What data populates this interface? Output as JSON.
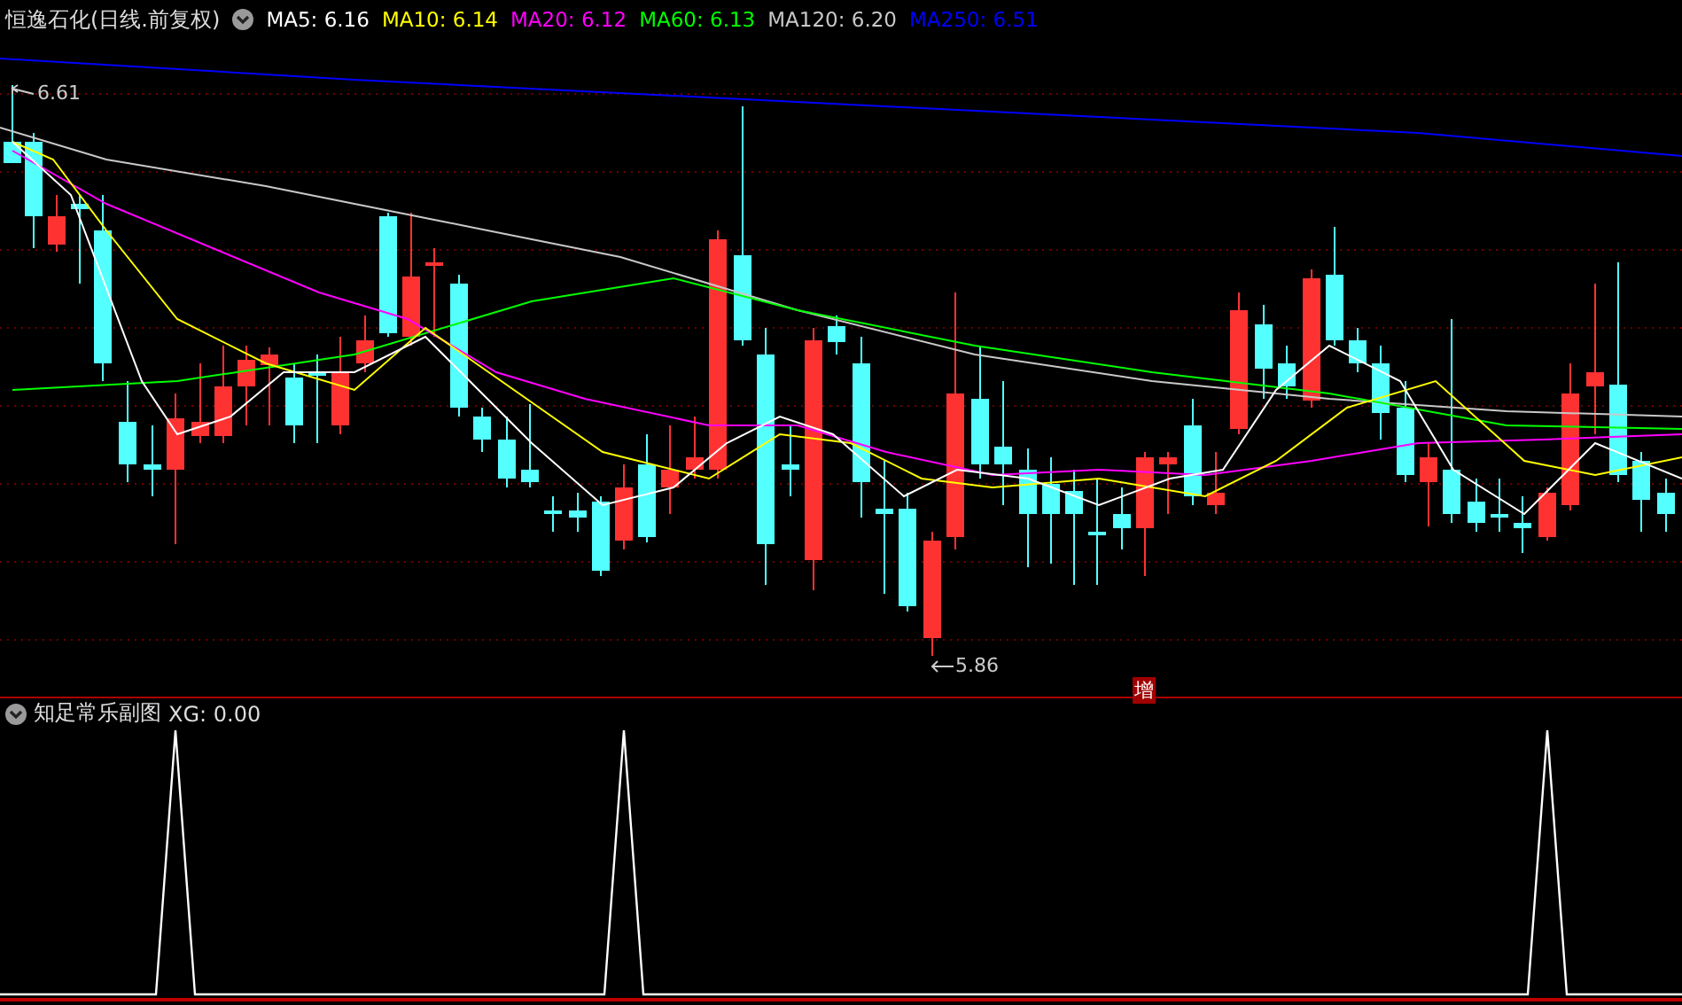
{
  "main_chart": {
    "title": "恒逸石化(日线.前复权)",
    "indicators": [
      {
        "label": "MA5: 6.16",
        "color": "#ffffff"
      },
      {
        "label": "MA10: 6.14",
        "color": "#ffff00"
      },
      {
        "label": "MA20: 6.12",
        "color": "#ff00ff"
      },
      {
        "label": "MA60: 6.13",
        "color": "#00ff00"
      },
      {
        "label": "MA120: 6.20",
        "color": "#c8c8c8"
      },
      {
        "label": "MA250: 6.51",
        "color": "#0000ff"
      }
    ],
    "high_marker": "6.61",
    "low_marker": "5.86",
    "badge": "增"
  },
  "sub_chart": {
    "title": "知足常乐副图",
    "indicator": "XG: 0.00"
  }
}
